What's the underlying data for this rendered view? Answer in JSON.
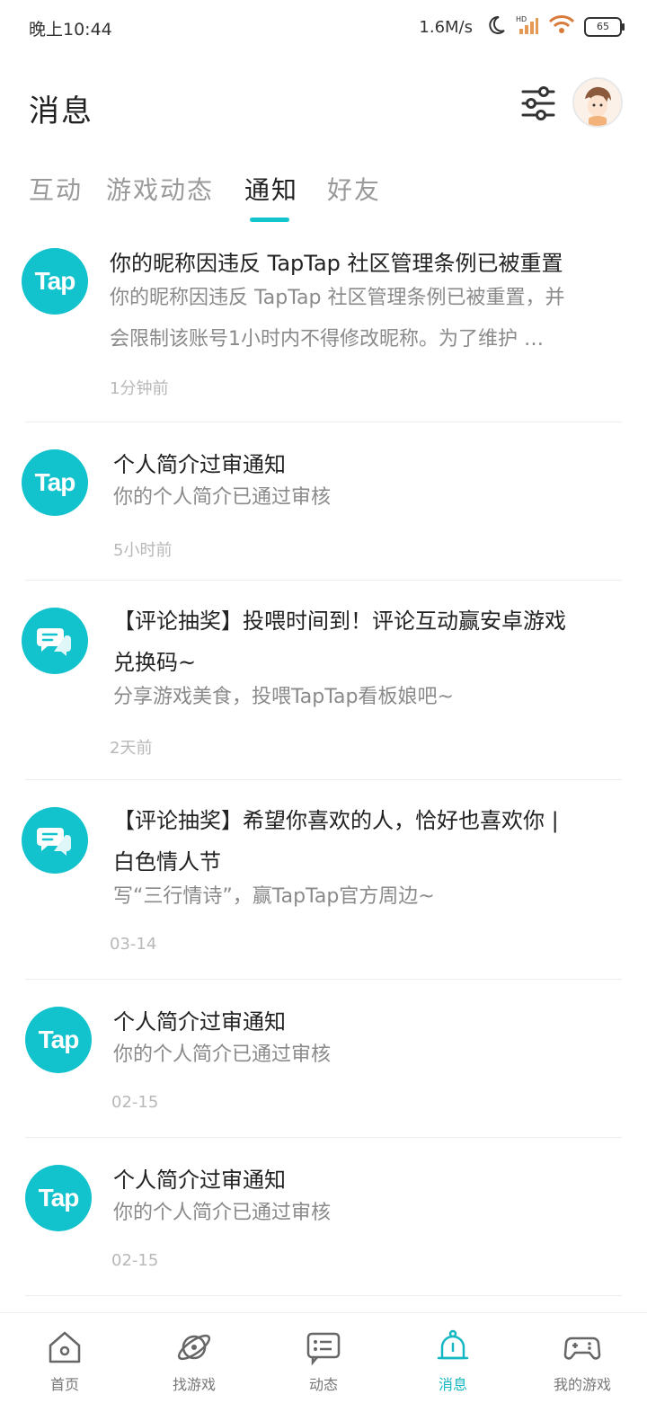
{
  "status_bar": {
    "time": "晚上10:44",
    "speed": "1.6M/s",
    "hd": "HD",
    "battery": "65"
  },
  "header": {
    "title": "消息"
  },
  "tabs": [
    {
      "label": "互动",
      "active": false
    },
    {
      "label": "游戏动态",
      "active": false
    },
    {
      "label": "通知",
      "active": true
    },
    {
      "label": "好友",
      "active": false
    }
  ],
  "notifications": [
    {
      "icon": "taptap-logo",
      "title": "你的昵称因违反 TapTap 社区管理条例已被重置",
      "desc_line1": "你的昵称因违反 TapTap 社区管理条例已被重置，并",
      "desc_line2": "会限制该账号1小时内不得修改昵称。为了维护 …",
      "time": "1分钟前"
    },
    {
      "icon": "taptap-logo",
      "title": "个人简介过审通知",
      "desc_line1": "你的个人简介已通过审核",
      "time": "5小时前"
    },
    {
      "icon": "chat-bubble-icon",
      "title_line1": "【评论抽奖】投喂时间到！评论互动赢安卓游戏",
      "title_line2": "兑换码~",
      "desc_line1": "分享游戏美食，投喂TapTap看板娘吧~",
      "time": "2天前"
    },
    {
      "icon": "chat-bubble-icon",
      "title_line1": "【评论抽奖】希望你喜欢的人，恰好也喜欢你 |",
      "title_line2": "白色情人节",
      "desc_line1": "写“三行情诗”，赢TapTap官方周边~",
      "time": "03-14"
    },
    {
      "icon": "taptap-logo",
      "title": "个人简介过审通知",
      "desc_line1": "你的个人简介已通过审核",
      "time": "02-15"
    },
    {
      "icon": "taptap-logo",
      "title": "个人简介过审通知",
      "desc_line1": "你的个人简介已通过审核",
      "time": "02-15"
    }
  ],
  "tap_logo_text": "Tap",
  "bottom_nav": [
    {
      "label": "首页",
      "icon": "home-icon",
      "active": false
    },
    {
      "label": "找游戏",
      "icon": "planet-icon",
      "active": false
    },
    {
      "label": "动态",
      "icon": "feed-icon",
      "active": false
    },
    {
      "label": "消息",
      "icon": "bell-icon",
      "active": true
    },
    {
      "label": "我的游戏",
      "icon": "gamepad-icon",
      "active": false
    }
  ],
  "colors": {
    "accent": "#15c5ce",
    "text_primary": "#222222",
    "text_secondary": "#8a8a8a",
    "text_muted": "#b8b8b8"
  }
}
